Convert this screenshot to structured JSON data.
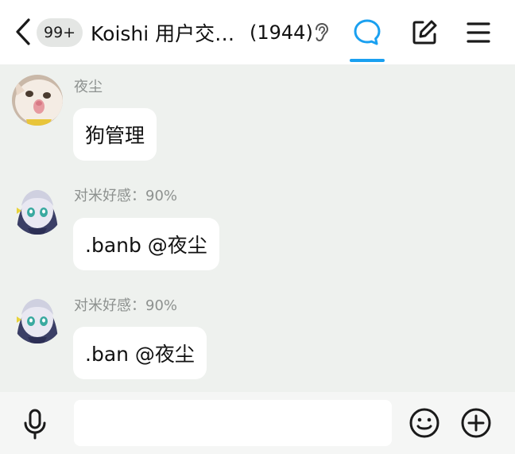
{
  "header": {
    "unread_badge": "99+",
    "title": "Koishi 用户交…",
    "member_count": "(1944)",
    "icons": {
      "back": "chevron-left-icon",
      "listen": "ear-icon",
      "chat_tab": "chat-bubble-icon",
      "edit": "edit-icon",
      "menu": "menu-icon"
    },
    "accent_color": "#1aa0f0"
  },
  "messages": [
    {
      "sender": "夜尘",
      "text": "狗管理",
      "avatar": "cat-avatar"
    },
    {
      "sender": "对米好感：90%",
      "text": ".banb @夜尘",
      "avatar": "anime-avatar"
    },
    {
      "sender": "对米好感：90%",
      "text": ".ban @夜尘",
      "avatar": "anime-avatar"
    }
  ],
  "input": {
    "placeholder": "",
    "icons": {
      "voice": "microphone-icon",
      "emoji": "smiley-icon",
      "more": "plus-circle-icon"
    }
  }
}
